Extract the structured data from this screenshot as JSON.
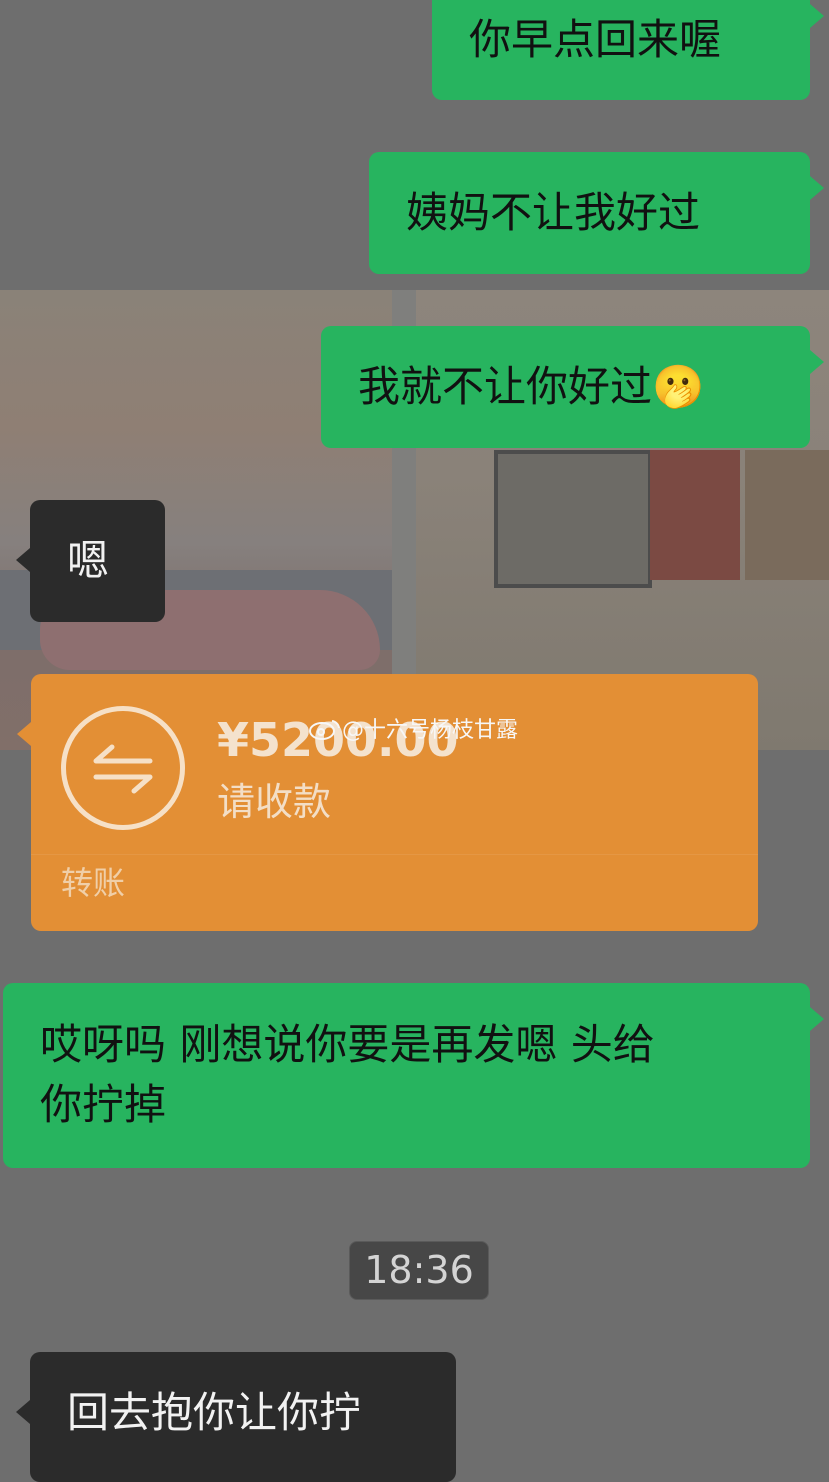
{
  "messages": [
    {
      "id": "msg1",
      "side": "me",
      "text": "你早点回来喔"
    },
    {
      "id": "msg2",
      "side": "me",
      "text": "姨妈不让我好过"
    },
    {
      "id": "msg3",
      "side": "me",
      "text": "我就不让你好过",
      "emoji": "🫢"
    },
    {
      "id": "msg4",
      "side": "them",
      "text": "嗯"
    },
    {
      "id": "msg6",
      "side": "me",
      "text_line1": "哎呀吗 刚想说你要是再发嗯 头给",
      "text_line2": "你拧掉"
    },
    {
      "id": "msg7",
      "side": "them",
      "text": "回去抱你让你拧"
    }
  ],
  "transfer": {
    "amount": "¥5200.00",
    "note": "请收款",
    "type": "转账",
    "icon": "transfer-arrows-icon"
  },
  "watermark": {
    "icon": "weibo-icon",
    "text": "@十六号杨枝甘露"
  },
  "timestamp": "18:36",
  "colors": {
    "my_bubble": "#27b45f",
    "their_bubble": "#2b2b2b",
    "transfer_card": "#e38f35",
    "chat_background": "#6e6e6e"
  }
}
